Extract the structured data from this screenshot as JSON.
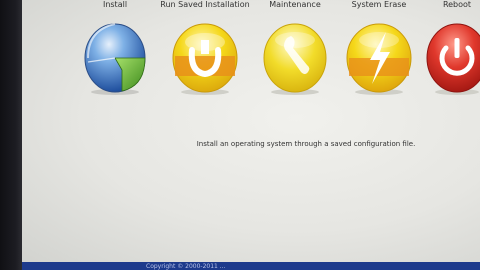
{
  "menu": {
    "items": [
      {
        "label": "Install",
        "icon": "install-globe-icon"
      },
      {
        "label": "Run Saved Installation",
        "icon": "saved-installation-icon"
      },
      {
        "label": "Maintenance",
        "icon": "wrench-icon"
      },
      {
        "label": "System Erase",
        "icon": "lightning-icon"
      },
      {
        "label": "Reboot",
        "icon": "power-icon"
      }
    ]
  },
  "description": "Install an operating system through a saved configuration file.",
  "footer": {
    "copyright": "Copyright © 2000-2011 ..."
  },
  "colors": {
    "background": "#e6e6e2",
    "footer": "#1d3a8c",
    "install_blue": "#2f6fc4",
    "install_green": "#5aa52a",
    "yellow": "#f2d21a",
    "orange": "#e58a10",
    "reboot_red": "#d42a22"
  }
}
